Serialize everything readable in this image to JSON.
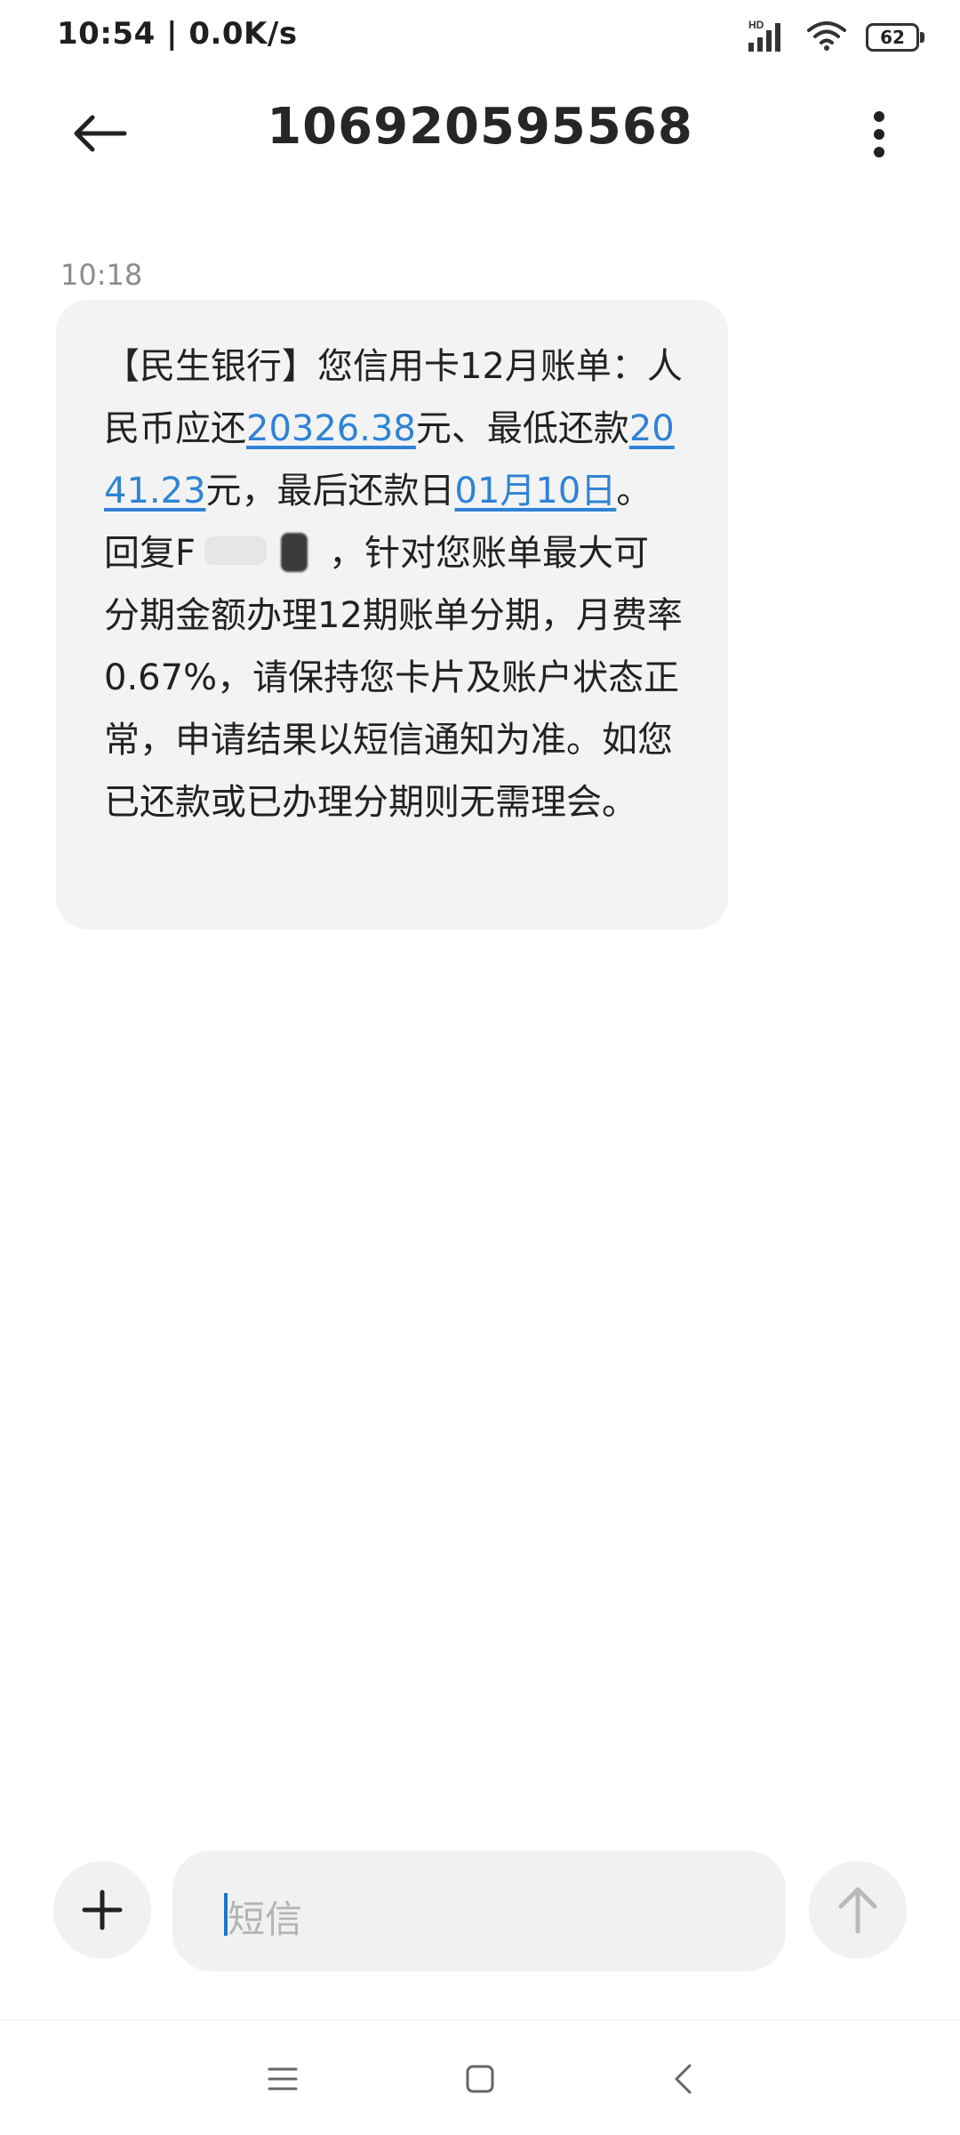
{
  "status_bar": {
    "time": "10:54 | 0.0K/s",
    "signal_label": "HD",
    "battery": "62",
    "icons": [
      "hd-signal-icon",
      "wifi-icon",
      "battery-icon"
    ]
  },
  "header": {
    "title": "106920595568",
    "back_icon": "back-arrow-icon",
    "more_icon": "more-vertical-icon"
  },
  "message": {
    "time": "10:18",
    "parts": {
      "p1": "【民生银行】您信用卡12月账单：人民币应还",
      "amount_due": "20326.38",
      "p2": "元、最低还款",
      "min_payment": "2041.23",
      "p3": "元，最后还款日",
      "due_date": "01月10日",
      "p4": "。回复F",
      "p5": "，针对您账单最大可分期金额办理12期账单分期，月费率0.67%，请保持您卡片及账户状态正常，申请结果以短信通知为准。如您已还款或已办理分期则无需理会。"
    }
  },
  "composer": {
    "placeholder": "短信",
    "add_icon": "plus-icon",
    "send_icon": "send-arrow-up-icon"
  },
  "nav_bar": {
    "icons": [
      "menu-icon",
      "home-square-icon",
      "back-chevron-icon"
    ]
  },
  "colors": {
    "link": "#2f83d6",
    "bubble_bg": "#f3f3f3",
    "caret": "#1976d2"
  }
}
